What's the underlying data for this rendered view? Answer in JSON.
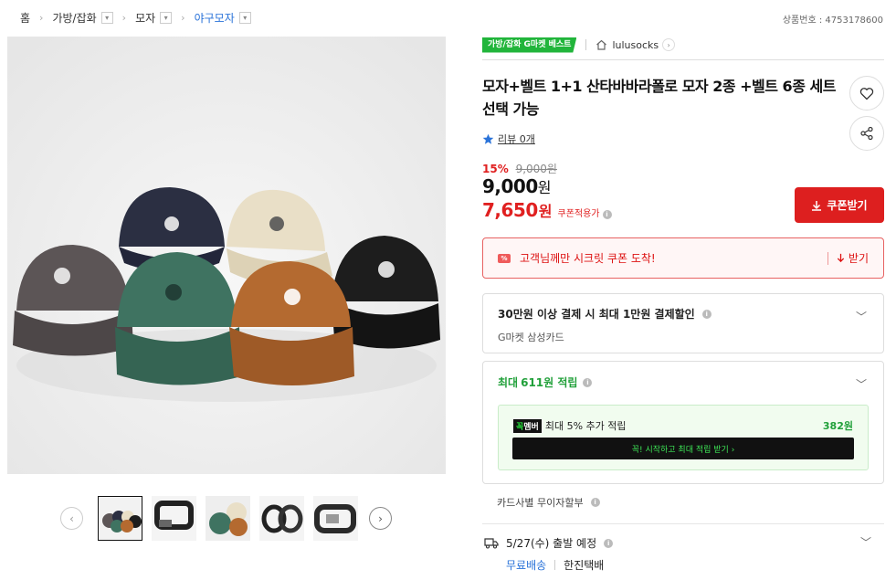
{
  "breadcrumb": {
    "home": "홈",
    "level1": "가방/잡화",
    "level2": "모자",
    "level3": "야구모자",
    "dropdown_icon": "chevron-down-icon"
  },
  "product_number": "상품번호 : 4753178600",
  "badge": {
    "best": "가방/잡화 G마켓 베스트"
  },
  "seller": {
    "name": "lulusocks"
  },
  "title": "모자+벨트 1+1 산타바바라폴로 모자 2종 +벨트 6종 세트 선택 가능",
  "review": {
    "text": "리뷰 0개"
  },
  "pricing": {
    "discount": "15%",
    "original": "9,000원",
    "price": "9,000",
    "price_unit": "원",
    "coupon_price": "7,650",
    "coupon_unit": "원",
    "coupon_label": "쿠폰적용가"
  },
  "coupon_button": "쿠폰받기",
  "secret_coupon": {
    "text": "고객님께만 시크릿 쿠폰 도착!",
    "action": "받기"
  },
  "card_discount": {
    "title": "30만원 이상 결제 시 최대 1만원 결제할인",
    "sub": "G마켓 삼성카드"
  },
  "points": {
    "prefix": "최대 ",
    "amount": "611",
    "suffix": "원 적립",
    "club_tag_green": "꼭",
    "club_tag_white": "멤버",
    "club_text": "최대 5% 추가 적립",
    "club_amount": "382원",
    "club_button": "꼭! 시작하고 최대 적립 받기 ›"
  },
  "installment": "카드사별 무이자할부",
  "shipping": {
    "date": "5/27(수) 출발 예정",
    "free": "무료배송",
    "carrier": "한진택배"
  },
  "colors": {
    "accent_red": "#dd1f1f",
    "accent_green": "#21a03a",
    "link_blue": "#2a73d9"
  }
}
